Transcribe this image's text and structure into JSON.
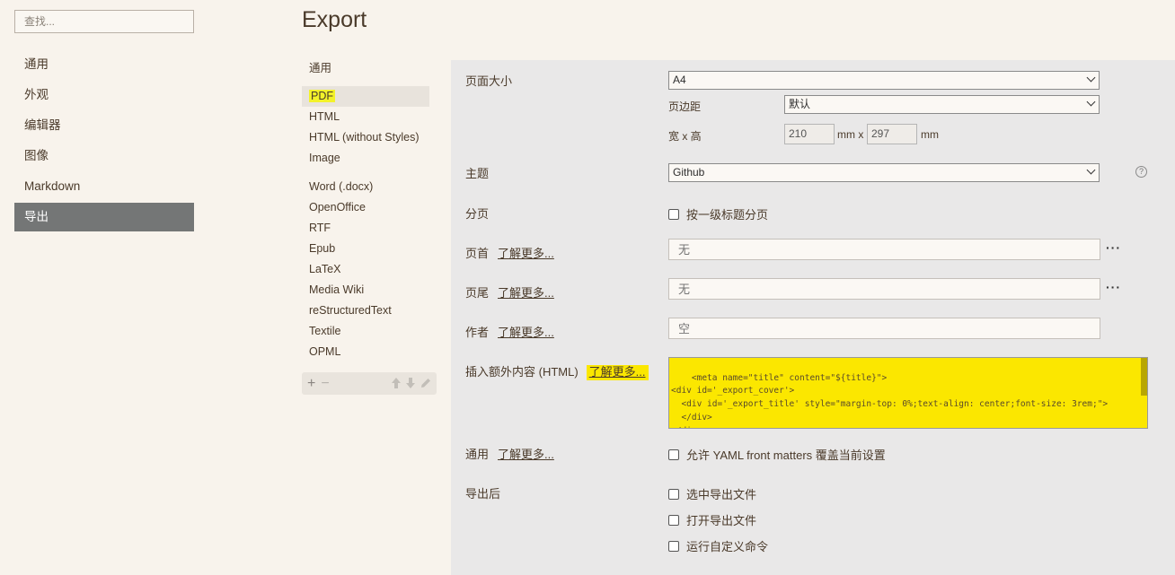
{
  "search": {
    "placeholder": "查找..."
  },
  "nav": [
    {
      "label": "通用"
    },
    {
      "label": "外观"
    },
    {
      "label": "编辑器"
    },
    {
      "label": "图像"
    },
    {
      "label": "Markdown"
    },
    {
      "label": "导出",
      "active": true
    }
  ],
  "page_title": "Export",
  "formats": [
    "通用",
    "PDF",
    "HTML",
    "HTML (without Styles)",
    "Image",
    "Word (.docx)",
    "OpenOffice",
    "RTF",
    "Epub",
    "LaTeX",
    "Media Wiki",
    "reStructuredText",
    "Textile",
    "OPML"
  ],
  "selected_format": "PDF",
  "toolbar": {
    "add": "+",
    "remove": "−",
    "up": "🡑",
    "down": "🡓",
    "edit": "✎"
  },
  "settings": {
    "page_size": {
      "label": "页面大小",
      "value": "A4"
    },
    "margin": {
      "label": "页边距",
      "value": "默认"
    },
    "dimensions": {
      "label": "宽 x 高",
      "width": "210",
      "height": "297",
      "unit1": "mm x",
      "unit2": "mm"
    },
    "theme": {
      "label": "主题",
      "value": "Github",
      "help": "?"
    },
    "pagination": {
      "label": "分页",
      "checkbox": "按一级标题分页"
    },
    "header": {
      "label": "页首",
      "learn": "了解更多...",
      "placeholder": "无"
    },
    "footer": {
      "label": "页尾",
      "learn": "了解更多...",
      "placeholder": "无"
    },
    "author": {
      "label": "作者",
      "learn": "了解更多...",
      "placeholder": "空"
    },
    "extra_html": {
      "label": "插入额外内容 (HTML)",
      "learn": "了解更多...",
      "code": "<meta name=\"title\" content=\"${title}\">\n<div id='_export_cover'>\n  <div id='_export_title' style=\"margin-top: 0%;text-align: center;font-size: 3rem;\">\n  </div>\n</div>"
    },
    "general": {
      "label": "通用",
      "learn": "了解更多...",
      "checkbox": "允许 YAML front matters 覆盖当前设置"
    },
    "after_export": {
      "label": "导出后",
      "options": [
        "选中导出文件",
        "打开导出文件",
        "运行自定义命令"
      ]
    }
  },
  "colors": {
    "background": "#f8f3ec",
    "panel": "#e9e8e8",
    "nav_active": "#747676",
    "highlight": "#fbe700"
  }
}
